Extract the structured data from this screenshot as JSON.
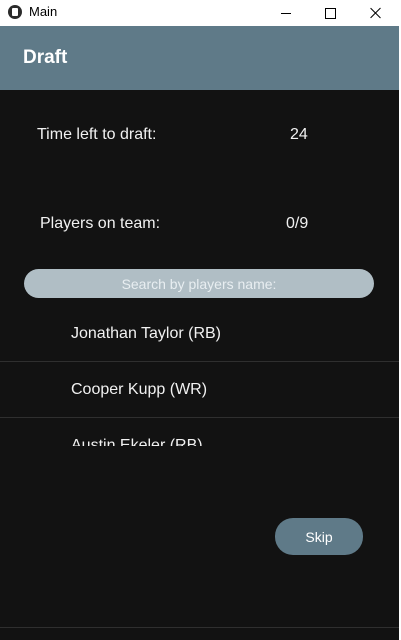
{
  "window": {
    "title": "Main",
    "app_icon": "kivy-icon",
    "controls": [
      "minimize-icon",
      "maximize-icon",
      "close-icon"
    ]
  },
  "header": {
    "title": "Draft",
    "background": "#5f7a88"
  },
  "timer": {
    "label": "Time left to draft:",
    "value": "24"
  },
  "team": {
    "label": "Players on team:",
    "value": "0/9"
  },
  "search": {
    "placeholder": "Search by players name:",
    "value": ""
  },
  "players": [
    {
      "label": "Jonathan Taylor (RB)"
    },
    {
      "label": "Cooper Kupp (WR)"
    },
    {
      "label": "Austin Ekeler (RB)"
    }
  ],
  "actions": {
    "skip_label": "Skip"
  },
  "colors": {
    "background": "#121212",
    "accent": "#5f7a88",
    "search_bg": "#b0bec5"
  }
}
